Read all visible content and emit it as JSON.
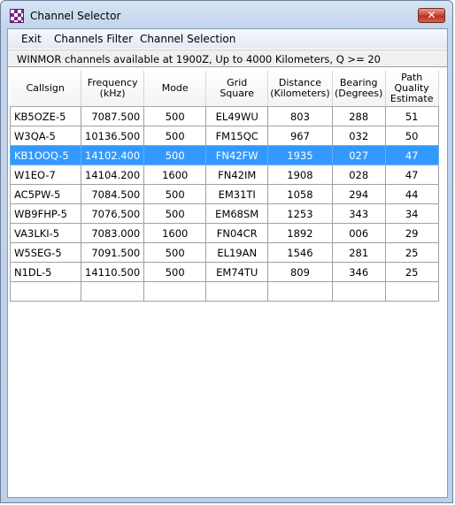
{
  "window": {
    "title": "Channel Selector",
    "close_glyph": "✕"
  },
  "menu": {
    "items": [
      "Exit",
      "Channels Filter",
      "Channel Selection"
    ]
  },
  "status": {
    "text": "WINMOR channels available at 1900Z, Up to 4000 Kilometers, Q >= 20"
  },
  "table": {
    "headers": [
      [
        "Callsign"
      ],
      [
        "Frequency",
        "(kHz)"
      ],
      [
        "Mode"
      ],
      [
        "Grid",
        "Square"
      ],
      [
        "Distance",
        "(Kilometers)"
      ],
      [
        "Bearing",
        "(Degrees)"
      ],
      [
        "Path",
        "Quality",
        "Estimate"
      ]
    ],
    "rows": [
      [
        "KB5OZE-5",
        "7087.500",
        "500",
        "EL49WU",
        "803",
        "288",
        "51"
      ],
      [
        "W3QA-5",
        "10136.500",
        "500",
        "FM15QC",
        "967",
        "032",
        "50"
      ],
      [
        "KB1OOQ-5",
        "14102.400",
        "500",
        "FN42FW",
        "1935",
        "027",
        "47"
      ],
      [
        "W1EO-7",
        "14104.200",
        "1600",
        "FN42IM",
        "1908",
        "028",
        "47"
      ],
      [
        "AC5PW-5",
        "7084.500",
        "500",
        "EM31TI",
        "1058",
        "294",
        "44"
      ],
      [
        "WB9FHP-5",
        "7076.500",
        "500",
        "EM68SM",
        "1253",
        "343",
        "34"
      ],
      [
        "VA3LKI-5",
        "7083.000",
        "1600",
        "FN04CR",
        "1892",
        "006",
        "29"
      ],
      [
        "W5SEG-5",
        "7091.500",
        "500",
        "EL19AN",
        "1546",
        "281",
        "25"
      ],
      [
        "N1DL-5",
        "14110.500",
        "500",
        "EM74TU",
        "809",
        "346",
        "25"
      ],
      [
        "",
        "",
        "",
        "",
        "",
        "",
        ""
      ]
    ],
    "selected_row": 2,
    "selection_color": "#3399ff"
  }
}
